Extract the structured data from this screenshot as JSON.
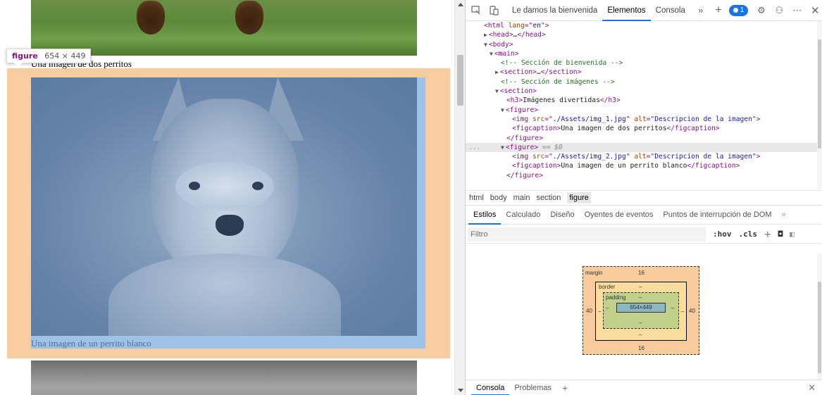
{
  "page": {
    "caption_1": "Una imagen de dos perritos",
    "caption_2": "Una imagen de un perrito blanco",
    "tooltip": {
      "tag": "figure",
      "dims": "654 × 449"
    }
  },
  "devtools": {
    "toolbar": {
      "tabs": [
        "Le damos la bienvenida",
        "Elementos",
        "Consola"
      ],
      "active_tab": "Elementos",
      "issue_count": "1"
    },
    "dom": {
      "lines": [
        {
          "indent": 0,
          "tri": "",
          "html": [
            [
              "t-tag",
              "<html "
            ],
            [
              "t-attr",
              "lang"
            ],
            [
              "t-tag",
              "=\""
            ],
            [
              "t-val",
              "en"
            ],
            [
              "t-tag",
              "\">"
            ]
          ]
        },
        {
          "indent": 1,
          "tri": "▶",
          "html": [
            [
              "t-tag",
              "<head>"
            ],
            [
              "t-text",
              "…"
            ],
            [
              "t-tag",
              "</head>"
            ]
          ]
        },
        {
          "indent": 1,
          "tri": "▼",
          "html": [
            [
              "t-tag",
              "<body>"
            ]
          ]
        },
        {
          "indent": 2,
          "tri": "▼",
          "html": [
            [
              "t-tag",
              "<main>"
            ]
          ]
        },
        {
          "indent": 3,
          "tri": "",
          "html": [
            [
              "t-comment",
              "<!-- Sección de bienvenida -->"
            ]
          ]
        },
        {
          "indent": 3,
          "tri": "▶",
          "html": [
            [
              "t-tag",
              "<section>"
            ],
            [
              "t-text",
              "…"
            ],
            [
              "t-tag",
              "</section>"
            ]
          ]
        },
        {
          "indent": 3,
          "tri": "",
          "html": [
            [
              "t-comment",
              "<!-- Sección de imágenes -->"
            ]
          ]
        },
        {
          "indent": 3,
          "tri": "▼",
          "html": [
            [
              "t-tag",
              "<section>"
            ]
          ]
        },
        {
          "indent": 4,
          "tri": "",
          "html": [
            [
              "t-tag",
              "<h3>"
            ],
            [
              "t-text",
              "Imágenes divertidas"
            ],
            [
              "t-tag",
              "</h3>"
            ]
          ]
        },
        {
          "indent": 4,
          "tri": "▼",
          "html": [
            [
              "t-tag",
              "<figure>"
            ]
          ]
        },
        {
          "indent": 5,
          "tri": "",
          "html": [
            [
              "t-tag",
              "<img "
            ],
            [
              "t-attr",
              "src"
            ],
            [
              "t-tag",
              "=\""
            ],
            [
              "t-val",
              "./Assets/img_1.jpg"
            ],
            [
              "t-tag",
              "\" "
            ],
            [
              "t-attr",
              "alt"
            ],
            [
              "t-tag",
              "=\""
            ],
            [
              "t-val",
              "Descripcion de la imagen"
            ],
            [
              "t-tag",
              "\">"
            ]
          ]
        },
        {
          "indent": 5,
          "tri": "",
          "html": [
            [
              "t-tag",
              "<figcaption>"
            ],
            [
              "t-text",
              "Una imagen de dos perritos"
            ],
            [
              "t-tag",
              "</figcaption>"
            ]
          ]
        },
        {
          "indent": 4,
          "tri": "",
          "html": [
            [
              "t-tag",
              "</figure>"
            ]
          ]
        },
        {
          "indent": 4,
          "tri": "▼",
          "selected": true,
          "html": [
            [
              "t-tag",
              "<figure>"
            ],
            [
              "t-sel",
              " == $0"
            ]
          ]
        },
        {
          "indent": 5,
          "tri": "",
          "html": [
            [
              "t-tag",
              "<img "
            ],
            [
              "t-attr",
              "src"
            ],
            [
              "t-tag",
              "=\""
            ],
            [
              "t-val",
              "./Assets/img_2.jpg"
            ],
            [
              "t-tag",
              "\" "
            ],
            [
              "t-attr",
              "alt"
            ],
            [
              "t-tag",
              "=\""
            ],
            [
              "t-val",
              "Descripcion de la imagen"
            ],
            [
              "t-tag",
              "\">"
            ]
          ]
        },
        {
          "indent": 5,
          "tri": "",
          "html": [
            [
              "t-tag",
              "<figcaption>"
            ],
            [
              "t-text",
              "Una imagen de un perrito blanco"
            ],
            [
              "t-tag",
              "</figcaption>"
            ]
          ]
        },
        {
          "indent": 4,
          "tri": "",
          "html": [
            [
              "t-tag",
              "</figure>"
            ]
          ]
        }
      ],
      "gutter_marker": "..."
    },
    "breadcrumbs": [
      "html",
      "body",
      "main",
      "section",
      "figure"
    ],
    "active_breadcrumb": "figure",
    "subtabs": [
      "Estilos",
      "Calculado",
      "Diseño",
      "Oyentes de eventos",
      "Puntos de interrupción de DOM"
    ],
    "active_subtab": "Estilos",
    "filter": {
      "placeholder": "Filtro",
      "hov": ":hov",
      "cls": ".cls"
    },
    "box_model": {
      "margin_label": "margin",
      "margin_top": "16",
      "margin_bottom": "16",
      "margin_left": "40",
      "margin_right": "40",
      "border_label": "border",
      "border_top": "–",
      "border_bottom": "–",
      "border_left": "–",
      "border_right": "–",
      "padding_label": "padding",
      "padding_top": "–",
      "padding_bottom": "–",
      "padding_left": "–",
      "padding_right": "–",
      "content": "654×449"
    },
    "drawer": {
      "tabs": [
        "Consola",
        "Problemas"
      ],
      "active": "Consola"
    }
  }
}
